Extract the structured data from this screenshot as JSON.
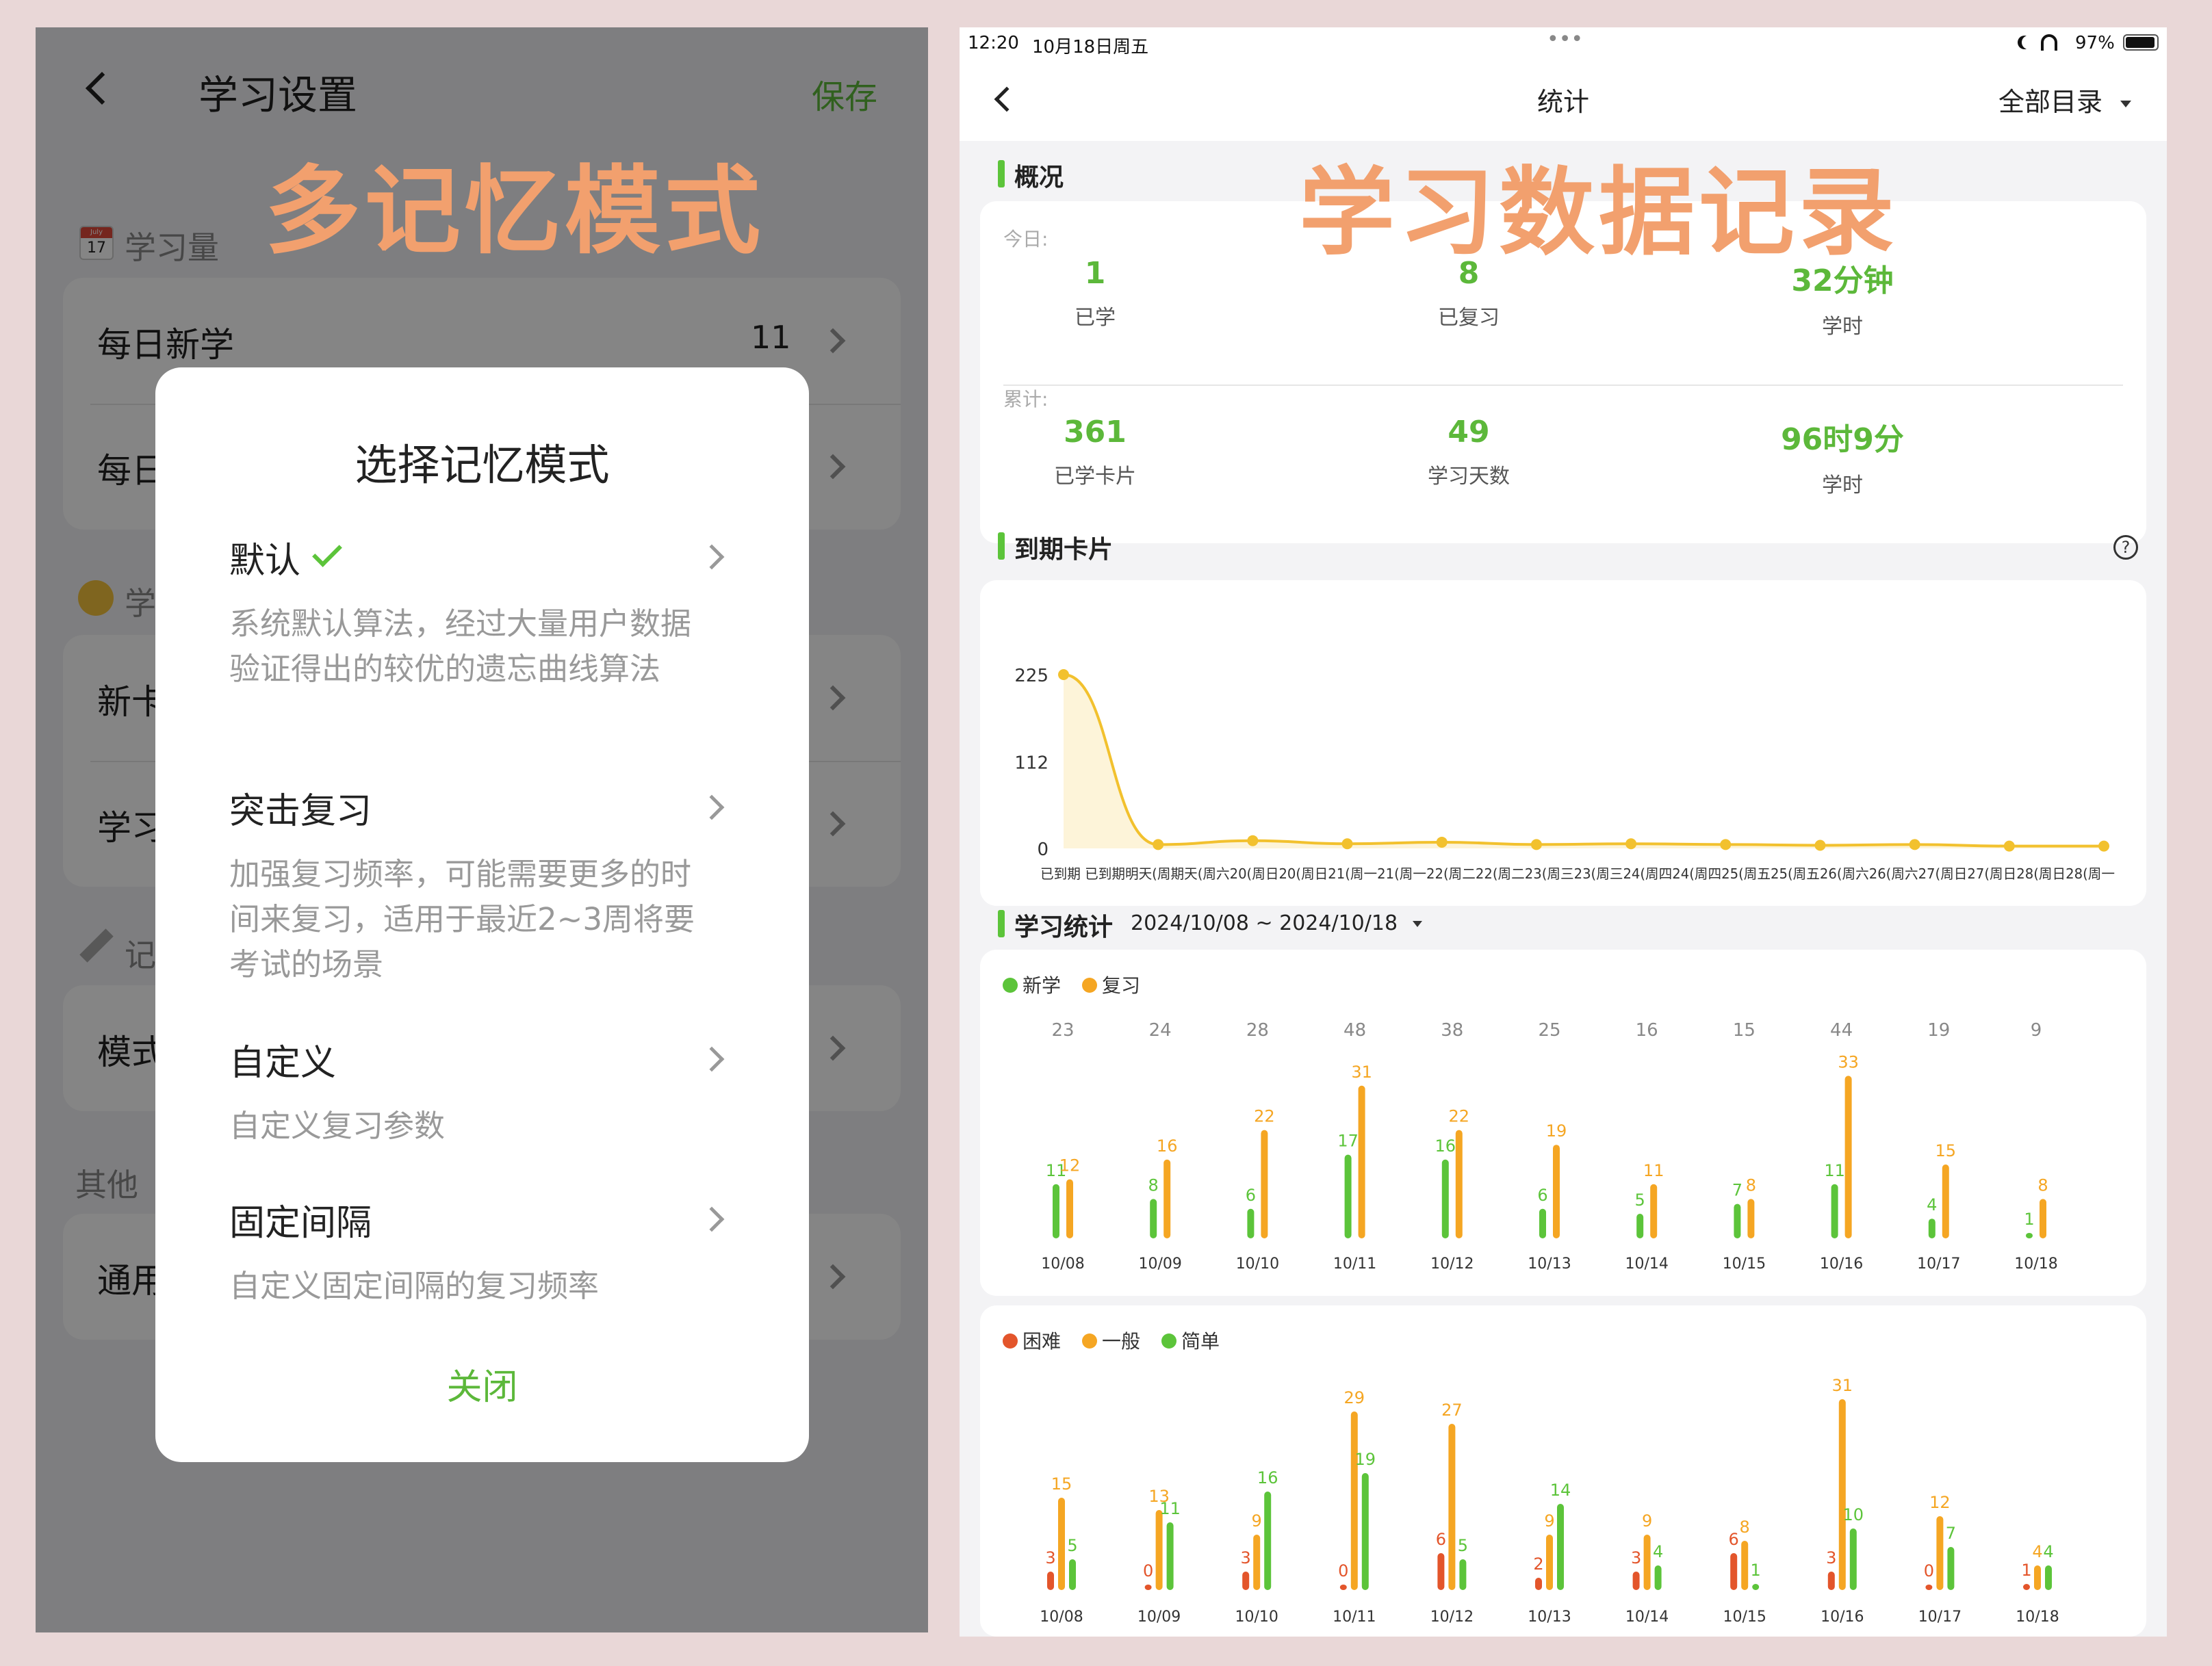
{
  "left": {
    "header": {
      "title": "学习设置",
      "save": "保存"
    },
    "watermark": "多记忆模式",
    "sections": {
      "study_amount": "学习量",
      "other": "其他"
    },
    "calendar_icon": {
      "month": "July",
      "day": "17"
    },
    "rows": [
      {
        "label": "每日新学",
        "value": "11"
      },
      {
        "label": "每日"
      },
      {
        "label": "新卡"
      },
      {
        "label": "学习"
      },
      {
        "label": "模式"
      },
      {
        "label": "通用"
      }
    ],
    "partial_sections": [
      "学",
      "记"
    ],
    "modal": {
      "title": "选择记忆模式",
      "options": [
        {
          "title": "默认",
          "desc": "系统默认算法，经过大量用户数据验证得出的较优的遗忘曲线算法",
          "checked": true
        },
        {
          "title": "突击复习",
          "desc": "加强复习频率，可能需要更多的时间来复习，适用于最近2~3周将要考试的场景"
        },
        {
          "title": "自定义",
          "desc": "自定义复习参数"
        },
        {
          "title": "固定间隔",
          "desc": "自定义固定间隔的复习频率"
        }
      ],
      "close": "关闭"
    }
  },
  "right": {
    "status_bar": {
      "time": "12:20",
      "date": "10月18日周五",
      "battery": "97%"
    },
    "nav": {
      "title": "统计",
      "filter": "全部目录"
    },
    "watermark": "学习数据记录",
    "overview": {
      "title": "概况",
      "today_label": "今日:",
      "total_label": "累计:",
      "today": [
        {
          "value": "1",
          "label": "已学"
        },
        {
          "value": "8",
          "label": "已复习"
        },
        {
          "value": "32分钟",
          "label": "学时"
        }
      ],
      "total": [
        {
          "value": "361",
          "label": "已学卡片"
        },
        {
          "value": "49",
          "label": "学习天数"
        },
        {
          "value": "96时9分",
          "label": "学时"
        }
      ]
    },
    "due_title": "到期卡片",
    "study_title": "学习统计",
    "date_range": "2024/10/08 ~ 2024/10/18",
    "colors": {
      "green": "#5cc43a",
      "orange": "#f5a623",
      "red": "#e3552b",
      "line": "#f2c12e"
    }
  },
  "chart_data": [
    {
      "type": "area",
      "title": "到期卡片",
      "yticks": [
        0,
        112,
        225
      ],
      "categories": [
        "已到期",
        "已到期",
        "明天(周六)",
        "10/20(周日)",
        "10/21(周一)",
        "10/22(周二)",
        "10/23(周三)",
        "10/24(周四)",
        "10/25(周五)",
        "10/26(周六)",
        "10/27(周日)",
        "10/28(周一)"
      ],
      "x_tick_text": "已到期 已到期明天(周期天(周六20(周日20(周日21(周一21(周一22(周二22(周二23(周三23(周三24(周四24(周四25(周五25(周五26(周六26(周六27(周日27(周日28(周日28(周一",
      "values": [
        225,
        5,
        10,
        6,
        8,
        5,
        6,
        5,
        4,
        5,
        3,
        3
      ]
    },
    {
      "type": "bar",
      "categories": [
        "10/08",
        "10/09",
        "10/10",
        "10/11",
        "10/12",
        "10/13",
        "10/14",
        "10/15",
        "10/16",
        "10/17",
        "10/18"
      ],
      "totals": [
        23,
        24,
        28,
        48,
        38,
        25,
        16,
        15,
        44,
        19,
        9
      ],
      "series": [
        {
          "name": "新学",
          "color": "#5cc43a",
          "values": [
            11,
            8,
            6,
            17,
            16,
            6,
            5,
            7,
            11,
            4,
            1
          ]
        },
        {
          "name": "复习",
          "color": "#f5a623",
          "values": [
            12,
            16,
            22,
            31,
            22,
            19,
            11,
            8,
            33,
            15,
            8
          ]
        }
      ]
    },
    {
      "type": "bar",
      "categories": [
        "10/08",
        "10/09",
        "10/10",
        "10/11",
        "10/12",
        "10/13",
        "10/14",
        "10/15",
        "10/16",
        "10/17",
        "10/18"
      ],
      "series": [
        {
          "name": "困难",
          "color": "#e3552b",
          "values": [
            3,
            0,
            3,
            0,
            6,
            2,
            3,
            6,
            3,
            0,
            1
          ]
        },
        {
          "name": "一般",
          "color": "#f5a623",
          "values": [
            15,
            13,
            9,
            29,
            27,
            9,
            9,
            8,
            31,
            12,
            4
          ]
        },
        {
          "name": "简单",
          "color": "#5cc43a",
          "values": [
            5,
            11,
            16,
            19,
            5,
            14,
            4,
            1,
            10,
            7,
            4
          ]
        }
      ]
    }
  ]
}
